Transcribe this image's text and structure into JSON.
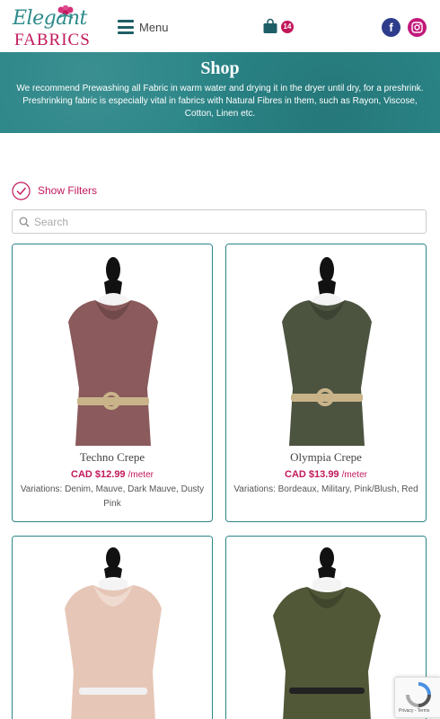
{
  "header": {
    "logo_script": "Elegant",
    "logo_word": "FABRICS",
    "menu_label": "Menu",
    "cart_count": "14",
    "facebook_glyph": "f"
  },
  "banner": {
    "title": "Shop",
    "text": "We recommend Prewashing all Fabric in warm water and drying it in the dryer until dry, for a preshrink. Preshrinking fabric is especially vital in fabrics with Natural Fibres in them, such as Rayon, Viscose, Cotton, Linen etc."
  },
  "filters": {
    "label": "Show Filters"
  },
  "search": {
    "placeholder": "Search"
  },
  "products": [
    {
      "name": "Techno Crepe",
      "price": "CAD $12.99",
      "unit": "/meter",
      "variations": "Variations: Denim, Mauve, Dark Mauve, Dusty Pink",
      "fabric_color": "#8a5a5c",
      "belt_color": "#c9b48a"
    },
    {
      "name": "Olympia Crepe",
      "price": "CAD $13.99",
      "unit": "/meter",
      "variations": "Variations: Bordeaux, Military, Pink/Blush, Red",
      "fabric_color": "#4c5440",
      "belt_color": "#c9b48a"
    },
    {
      "name": "",
      "price": "",
      "unit": "",
      "variations": "",
      "fabric_color": "#e6c6b6",
      "belt_color": "#f0f0f0"
    },
    {
      "name": "",
      "price": "",
      "unit": "",
      "variations": "",
      "fabric_color": "#505838",
      "belt_color": "#222222"
    }
  ],
  "recaptcha": {
    "text": "Privacy - Terms"
  },
  "colors": {
    "accent": "#c2185b",
    "teal": "#2a8587",
    "navy": "#1e5f67"
  }
}
